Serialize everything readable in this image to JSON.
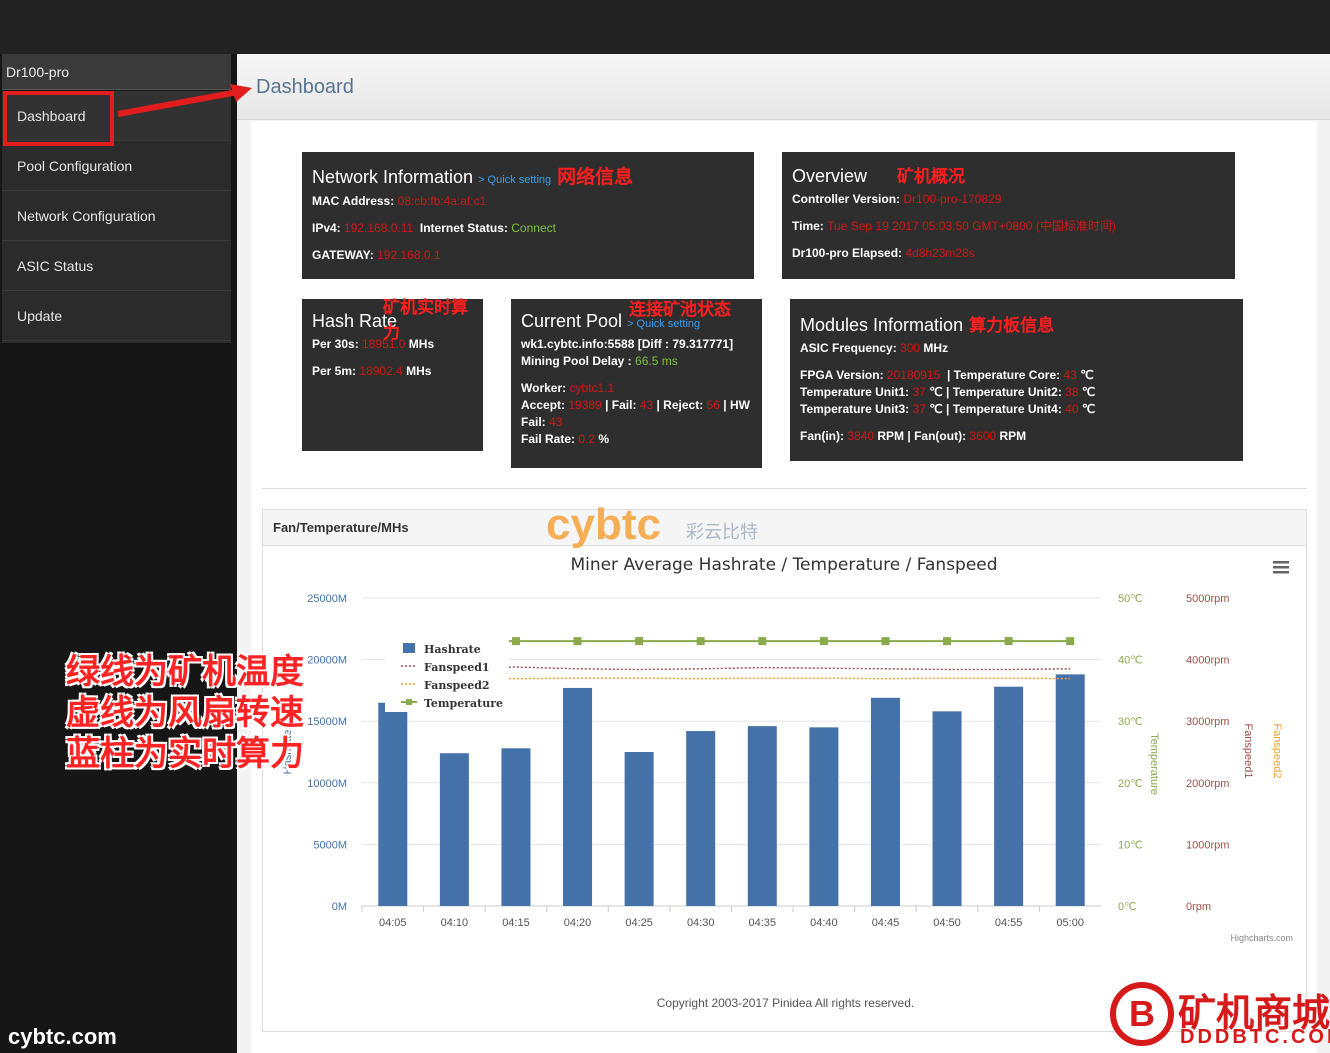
{
  "sidebar": {
    "brand": "Dr100-pro",
    "items": [
      {
        "label": "Dashboard"
      },
      {
        "label": "Pool Configuration"
      },
      {
        "label": "Network Configuration"
      },
      {
        "label": "ASIC Status"
      },
      {
        "label": "Update"
      }
    ]
  },
  "page": {
    "title": "Dashboard"
  },
  "network": {
    "title": "Network Information",
    "quick": "> Quick setting",
    "cn": "网络信息",
    "mac_label": "MAC Address:",
    "mac": "08:cb:fb:4a:af:c1",
    "ip_label": "IPv4:",
    "ip": "192.168.0.11",
    "status_label": "Internet Status:",
    "status": "Connect",
    "gw_label": "GATEWAY:",
    "gw": "192.168.0.1"
  },
  "overview": {
    "title": "Overview",
    "cn": "矿机概况",
    "ver_label": "Controller Version:",
    "ver": "Dr100-pro-170829",
    "time_label": "Time:",
    "time": "Tue Sep 19 2017 05:03:50 GMT+0800 (中国标准时间)",
    "el_label": "Dr100-pro Elapsed:",
    "el": "4d8h23m28s"
  },
  "hash": {
    "title": "Hash Rate",
    "cn": "矿机实时算力",
    "p30_label": "Per 30s:",
    "p30": "18951.0",
    "unit": "MHs",
    "p5_label": "Per 5m:",
    "p5": "18902.4"
  },
  "pool": {
    "title": "Current Pool",
    "quick": "> Quick setting",
    "cn": "连接矿池状态",
    "url": "wk1.cybtc.info:5588 [Diff : 79.317771]",
    "delay_label": "Mining Pool Delay :",
    "delay": "66.5 ms",
    "worker_label": "Worker:",
    "worker": "cybtc1.1",
    "accept_label": "Accept:",
    "accept": "19389",
    "fail_label": "| Fail:",
    "fail": "43",
    "reject_label": "| Reject:",
    "reject": "56",
    "hw": "| HW",
    "fail2_label": "Fail:",
    "fail2": "43",
    "rate_label": "Fail Rate:",
    "rate": "0.2",
    "rate_unit": "%"
  },
  "modules": {
    "title": "Modules Information",
    "cn": "算力板信息",
    "freq_label": "ASIC Frequency:",
    "freq": "300",
    "freq_unit": "MHz",
    "fpga_label": "FPGA Version:",
    "fpga": "20180915",
    "core_label": "| Temperature Core:",
    "core": "43",
    "u1_label": "Temperature Unit1:",
    "u1": "37",
    "u2_label": "℃ | Temperature Unit2:",
    "u2": "38",
    "u3_label": "Temperature Unit3:",
    "u3": "37",
    "u4_label": "℃ | Temperature Unit4:",
    "u4": "40",
    "deg": "℃",
    "fanin_label": "Fan(in):",
    "fanin": "3840",
    "fanout_label": "RPM | Fan(out):",
    "fanout": "3600",
    "rpm": "RPM"
  },
  "panel": {
    "title": "Fan/Temperature/MHs",
    "copyright": "Copyright 2003-2017 Pinidea All rights reserved."
  },
  "annotations": [
    "绿线为矿机温度",
    "虚线为风扇转速",
    "蓝柱为实时算力"
  ],
  "watermarks": {
    "bl": "cybtc.com",
    "br1": "矿机商城",
    "br2": "DDDBTC.COM",
    "mid1": "cybtc",
    "mid2": "彩云比特"
  },
  "chart_data": {
    "type": "bar",
    "title": "Miner Average Hashrate / Temperature / Fanspeed",
    "categories": [
      "04:05",
      "04:10",
      "04:15",
      "04:20",
      "04:25",
      "04:30",
      "04:35",
      "04:40",
      "04:45",
      "04:50",
      "04:55",
      "05:00"
    ],
    "yticks": [
      "0M",
      "5000M",
      "10000M",
      "15000M",
      "20000M",
      "25000M"
    ],
    "tticks": [
      "0℃",
      "10℃",
      "20℃",
      "30℃",
      "40℃",
      "50℃"
    ],
    "fticks": [
      "0rpm",
      "1000rpm",
      "2000rpm",
      "3000rpm",
      "4000rpm",
      "5000rpm"
    ],
    "yaxis_title": "Hashrate",
    "taxis_title": "Temperature",
    "f1axis_title": "Fanspeed1",
    "f2axis_title": "Fanspeed2",
    "credits": "Highcharts.com",
    "ylim": [
      0,
      25000
    ],
    "templim": [
      0,
      50
    ],
    "fanlim": [
      0,
      5000
    ],
    "colors": {
      "hash": "#4472a8",
      "temp": "#8aaa4c",
      "fan1": "#a0504c",
      "fan2": "#f0a030"
    },
    "series": [
      {
        "name": "Hashrate",
        "values": [
          16500,
          12400,
          12800,
          17700,
          12500,
          14200,
          14600,
          14500,
          16900,
          15800,
          17800,
          18800
        ]
      },
      {
        "name": "Fanspeed1",
        "values": [
          3840,
          3860,
          3880,
          3850,
          3840,
          3850,
          3870,
          3860,
          3850,
          3840,
          3840,
          3850
        ]
      },
      {
        "name": "Fanspeed2",
        "values": [
          3700,
          3700,
          3690,
          3700,
          3700,
          3690,
          3700,
          3700,
          3690,
          3700,
          3700,
          3690
        ]
      },
      {
        "name": "Temperature",
        "values": [
          43,
          43,
          43,
          43,
          43,
          43,
          43,
          43,
          43,
          43,
          43,
          43
        ]
      }
    ]
  }
}
